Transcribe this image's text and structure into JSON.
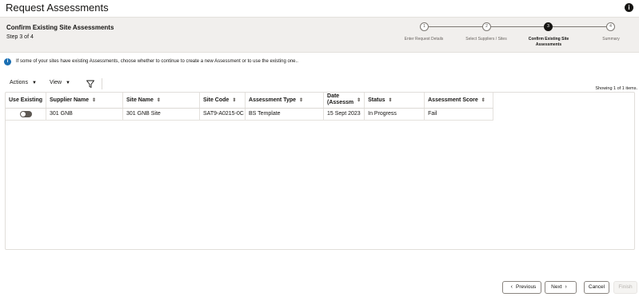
{
  "header": {
    "title": "Request Assessments",
    "info_icon": "info-icon"
  },
  "train": {
    "page_title": "Confirm Existing Site Assessments",
    "step_label": "Step 3 of 4",
    "steps": [
      {
        "num": "1",
        "label": "Enter Request Details"
      },
      {
        "num": "2",
        "label": "Select Suppliers / Sites"
      },
      {
        "num": "3",
        "label": "Confirm Existing Site Assessments"
      },
      {
        "num": "4",
        "label": "Summary"
      }
    ],
    "current_step": 3
  },
  "notice": {
    "icon": "info-icon",
    "message": "If some of your sites have existing Assessments, choose whether to continue to create a new Assessment or to use the existing one.."
  },
  "toolbar": {
    "actions_label": "Actions",
    "view_label": "View",
    "filter_icon": "filter-icon"
  },
  "showing": "Showing 1 of 1 items.",
  "table": {
    "columns": [
      "Use Existing",
      "Supplier Name",
      "Site Name",
      "Site Code",
      "Assessment Type",
      "Date (Assessm",
      "Status",
      "Assessment Score"
    ],
    "date_col_line1": "Date",
    "date_col_line2": "(Assessm",
    "rows": [
      {
        "use_existing": false,
        "supplier": "301 GNB",
        "site": "301 GNB Site",
        "site_code": "SAT9-A0215-0C",
        "type": "BS Template",
        "date": "15 Sept 2023",
        "status": "In Progress",
        "score": "Fail"
      }
    ]
  },
  "footer": {
    "previous": "Previous",
    "next": "Next",
    "cancel": "Cancel",
    "finish": "Finish"
  },
  "colors": {
    "accent": "#1a6fb3",
    "train_bg": "#f1efed",
    "current_step": "#161513"
  }
}
